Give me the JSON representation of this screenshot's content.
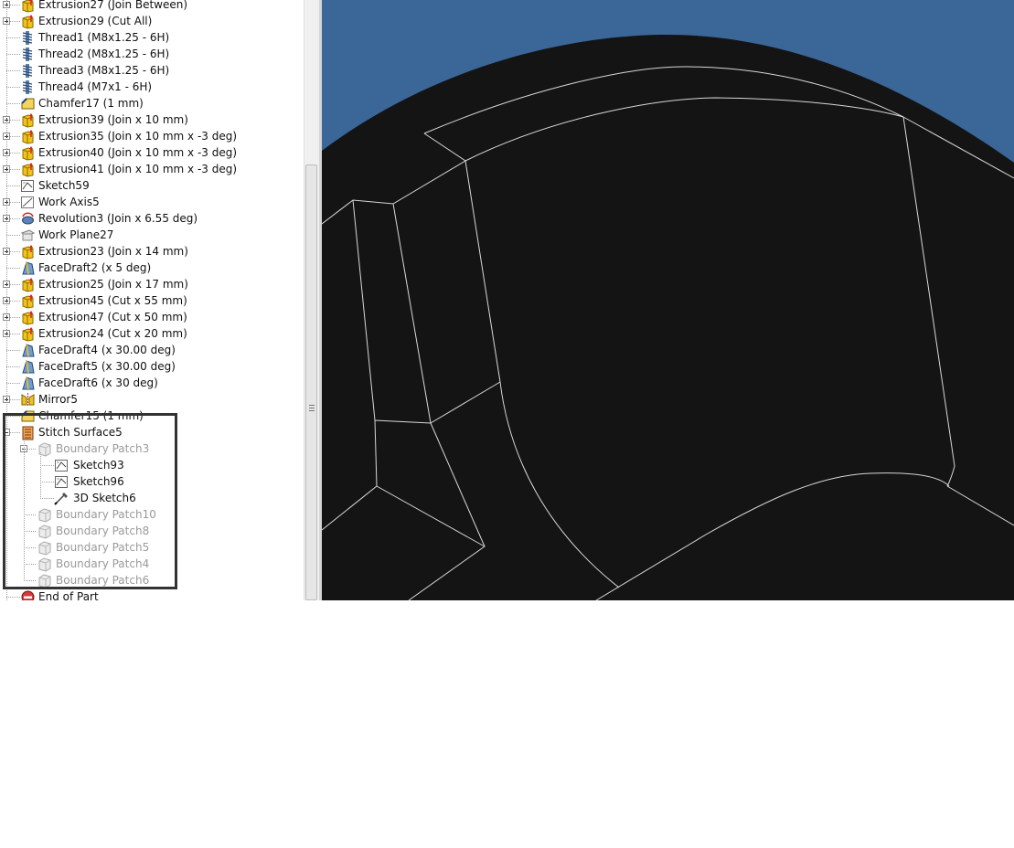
{
  "browser": {
    "items": [
      {
        "label": "Extrusion27 (Join Between)",
        "icon": "extrusion-icon",
        "expandable": true,
        "level": 0,
        "dim": false
      },
      {
        "label": "Extrusion29 (Cut All)",
        "icon": "extrusion-icon",
        "expandable": true,
        "level": 0,
        "dim": false
      },
      {
        "label": "Thread1 (M8x1.25 - 6H)",
        "icon": "thread-icon",
        "expandable": false,
        "level": 0,
        "dim": false
      },
      {
        "label": "Thread2 (M8x1.25 - 6H)",
        "icon": "thread-icon",
        "expandable": false,
        "level": 0,
        "dim": false
      },
      {
        "label": "Thread3 (M8x1.25 - 6H)",
        "icon": "thread-icon",
        "expandable": false,
        "level": 0,
        "dim": false
      },
      {
        "label": "Thread4 (M7x1 - 6H)",
        "icon": "thread-icon",
        "expandable": false,
        "level": 0,
        "dim": false
      },
      {
        "label": "Chamfer17 (1 mm)",
        "icon": "chamfer-icon",
        "expandable": false,
        "level": 0,
        "dim": false
      },
      {
        "label": "Extrusion39 (Join x 10 mm)",
        "icon": "extrusion-icon",
        "expandable": true,
        "level": 0,
        "dim": false
      },
      {
        "label": "Extrusion35 (Join x 10 mm x -3 deg)",
        "icon": "extrusion-icon",
        "expandable": true,
        "level": 0,
        "dim": false
      },
      {
        "label": "Extrusion40 (Join x 10 mm x -3 deg)",
        "icon": "extrusion-icon",
        "expandable": true,
        "level": 0,
        "dim": false
      },
      {
        "label": "Extrusion41 (Join x 10 mm x -3 deg)",
        "icon": "extrusion-icon",
        "expandable": true,
        "level": 0,
        "dim": false
      },
      {
        "label": "Sketch59",
        "icon": "sketch-icon",
        "expandable": false,
        "level": 0,
        "dim": false
      },
      {
        "label": "Work Axis5",
        "icon": "work-axis-icon",
        "expandable": true,
        "level": 0,
        "dim": false
      },
      {
        "label": "Revolution3 (Join x 6.55 deg)",
        "icon": "revolution-icon",
        "expandable": true,
        "level": 0,
        "dim": false
      },
      {
        "label": "Work Plane27",
        "icon": "work-plane-icon",
        "expandable": false,
        "level": 0,
        "dim": false
      },
      {
        "label": "Extrusion23 (Join x 14 mm)",
        "icon": "extrusion-icon",
        "expandable": true,
        "level": 0,
        "dim": false
      },
      {
        "label": "FaceDraft2 (x 5 deg)",
        "icon": "face-draft-icon",
        "expandable": false,
        "level": 0,
        "dim": false
      },
      {
        "label": "Extrusion25 (Join x 17 mm)",
        "icon": "extrusion-icon",
        "expandable": true,
        "level": 0,
        "dim": false
      },
      {
        "label": "Extrusion45 (Cut x 55 mm)",
        "icon": "extrusion-icon",
        "expandable": true,
        "level": 0,
        "dim": false
      },
      {
        "label": "Extrusion47 (Cut x 50 mm)",
        "icon": "extrusion-icon",
        "expandable": true,
        "level": 0,
        "dim": false
      },
      {
        "label": "Extrusion24 (Cut x 20 mm)",
        "icon": "extrusion-icon",
        "expandable": true,
        "level": 0,
        "dim": false
      },
      {
        "label": "FaceDraft4 (x 30.00 deg)",
        "icon": "face-draft-icon",
        "expandable": false,
        "level": 0,
        "dim": false
      },
      {
        "label": "FaceDraft5 (x 30.00 deg)",
        "icon": "face-draft-icon",
        "expandable": false,
        "level": 0,
        "dim": false
      },
      {
        "label": "FaceDraft6 (x 30 deg)",
        "icon": "face-draft-icon",
        "expandable": false,
        "level": 0,
        "dim": false
      },
      {
        "label": "Mirror5",
        "icon": "mirror-icon",
        "expandable": true,
        "level": 0,
        "dim": false
      },
      {
        "label": "Chamfer15 (1 mm)",
        "icon": "chamfer-icon",
        "expandable": false,
        "level": 0,
        "dim": false
      },
      {
        "label": "Stitch Surface5",
        "icon": "stitch-surface-icon",
        "expandable": true,
        "expanded": true,
        "level": 0,
        "dim": false
      },
      {
        "label": "Boundary Patch3",
        "icon": "boundary-patch-icon",
        "expandable": true,
        "expanded": true,
        "level": 1,
        "dim": true
      },
      {
        "label": "Sketch93",
        "icon": "sketch-icon",
        "expandable": false,
        "level": 2,
        "dim": false
      },
      {
        "label": "Sketch96",
        "icon": "sketch-icon",
        "expandable": false,
        "level": 2,
        "dim": false
      },
      {
        "label": "3D Sketch6",
        "icon": "3d-sketch-icon",
        "expandable": false,
        "level": 2,
        "dim": false
      },
      {
        "label": "Boundary Patch10",
        "icon": "boundary-patch-icon",
        "expandable": false,
        "level": 1,
        "dim": true
      },
      {
        "label": "Boundary Patch8",
        "icon": "boundary-patch-icon",
        "expandable": false,
        "level": 1,
        "dim": true
      },
      {
        "label": "Boundary Patch5",
        "icon": "boundary-patch-icon",
        "expandable": false,
        "level": 1,
        "dim": true
      },
      {
        "label": "Boundary Patch4",
        "icon": "boundary-patch-icon",
        "expandable": false,
        "level": 1,
        "dim": true
      },
      {
        "label": "Boundary Patch6",
        "icon": "boundary-patch-icon",
        "expandable": false,
        "level": 1,
        "dim": true
      },
      {
        "label": "End of Part",
        "icon": "end-of-part-icon",
        "expandable": false,
        "level": 0,
        "dim": false
      }
    ]
  },
  "viewport": {
    "background_color": "#3b6698",
    "model_color": "#141414",
    "edge_color": "#d8d8d8"
  }
}
